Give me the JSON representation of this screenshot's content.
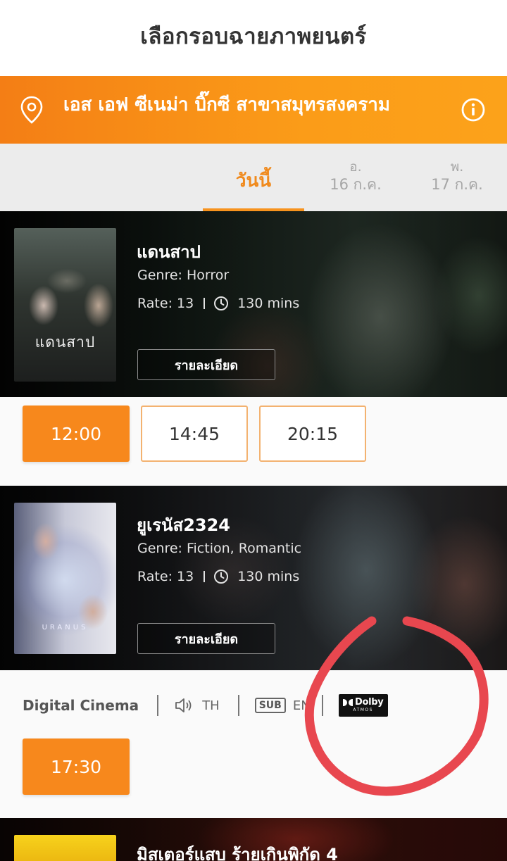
{
  "header": {
    "title": "เลือกรอบฉายภาพยนตร์"
  },
  "branch": {
    "name": "เอส เอฟ ซีเนม่า บิ๊กซี สาขาสมุทรสงคราม"
  },
  "date_tabs": [
    {
      "label": "วันนี้"
    },
    {
      "day": "อ.",
      "date": "16 ก.ค."
    },
    {
      "day": "พ.",
      "date": "17 ก.ค."
    }
  ],
  "movies": [
    {
      "title": "แดนสาป",
      "genre": "Genre: Horror",
      "rate": "Rate: 13",
      "duration": "130 mins",
      "detail_label": "รายละเอียด",
      "poster_text": "แดนสาป",
      "showtimes": [
        "12:00",
        "14:45",
        "20:15"
      ]
    },
    {
      "title": "ยูเรนัส2324",
      "genre": "Genre: Fiction, Romantic",
      "rate": "Rate: 13",
      "duration": "130 mins",
      "detail_label": "รายละเอียด",
      "poster_text": "URANUS",
      "format": {
        "cinema": "Digital Cinema",
        "audio": "TH",
        "sub_badge": "SUB",
        "subtitle": "EN",
        "dolby_top": "Dolby",
        "dolby_bottom": "ATMOS"
      },
      "showtimes": [
        "17:30"
      ]
    },
    {
      "title": "มิสเตอร์แสบ ร้ายเกินพิกัด 4"
    }
  ],
  "colors": {
    "accent": "#f7881c",
    "annotation": "#e8474f"
  },
  "icons": {
    "location": "pin-icon",
    "info": "info-icon",
    "clock": "clock-icon",
    "audio": "speaker-icon"
  }
}
